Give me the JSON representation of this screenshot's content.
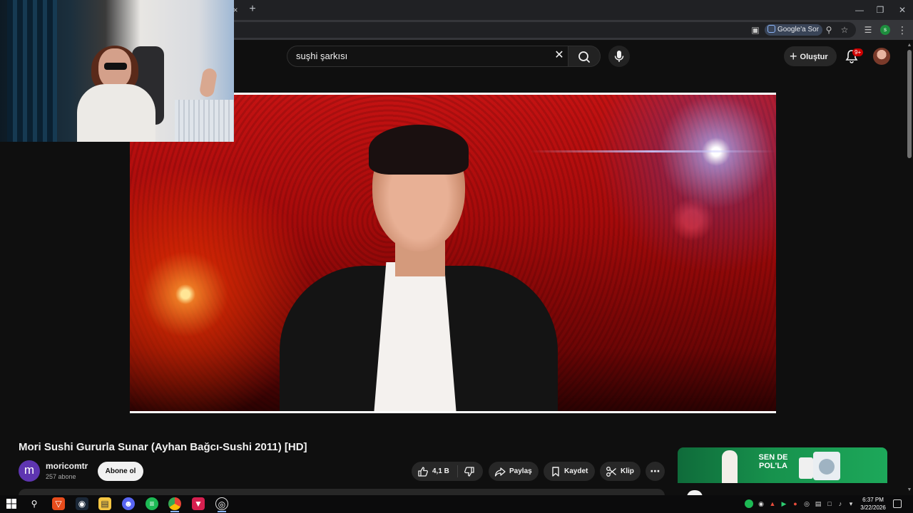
{
  "browser": {
    "close_tab_glyph": "×",
    "new_tab_glyph": "+",
    "ask_google_label": "Google'a Sor",
    "profile_initial": "s"
  },
  "youtube": {
    "search": {
      "value": "suşhi şarkısı"
    },
    "create_label": "Oluştur",
    "notification_count": "9+"
  },
  "video": {
    "title": "Mori Sushi Gururla Sunar (Ayhan Bağcı-Sushi 2011) [HD]",
    "channel": {
      "initial": "m",
      "name": "moricomtr",
      "subscribers": "257 abone"
    },
    "subscribe_label": "Abone ol",
    "actions": {
      "likes": "4,1 B",
      "share": "Paylaş",
      "save": "Kaydet",
      "clip": "Klip"
    }
  },
  "ad": {
    "headline": "SEN DE POL'LA"
  },
  "taskbar": {
    "time": "6:37 PM",
    "date": "3/22/2026"
  },
  "colors": {
    "background": "#0f0f0f",
    "accent_red": "#cc0000",
    "button_bg": "#272727"
  }
}
